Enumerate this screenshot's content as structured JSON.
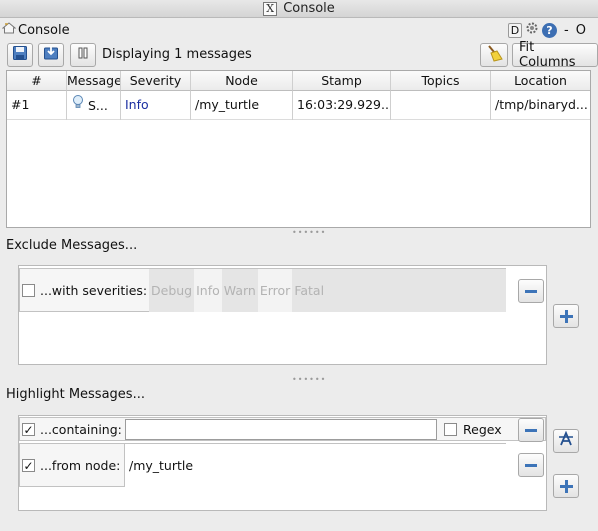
{
  "window": {
    "title": "Console"
  },
  "plugin": {
    "title": "Console",
    "header_buttons": {
      "d_label": "D",
      "help_label": "?",
      "minimize_label": "-",
      "close_label": "O"
    }
  },
  "toolbar": {
    "status_text": "Displaying 1 messages",
    "fit_columns_label": "Fit Columns"
  },
  "table": {
    "columns": [
      "#",
      "Message",
      "Severity",
      "Node",
      "Stamp",
      "Topics",
      "Location"
    ],
    "rows": [
      {
        "id": "#1",
        "message": "S...",
        "severity": "Info",
        "node": "/my_turtle",
        "stamp": "16:03:29.929...",
        "topics": "",
        "location": "/tmp/binaryd..."
      }
    ]
  },
  "exclude": {
    "label": "Exclude Messages...",
    "filter_label": "...with severities:",
    "severities": [
      "Debug",
      "Info",
      "Warn",
      "Error",
      "Fatal"
    ]
  },
  "highlight": {
    "label": "Highlight Messages...",
    "containing": {
      "label": "...containing:",
      "value": "",
      "checked": true,
      "regex_label": "Regex",
      "regex_checked": false
    },
    "from_node": {
      "label": "...from node:",
      "value": "/my_turtle",
      "checked": true
    }
  },
  "colors": {
    "accent": "#3d74b8",
    "severity_info": "#1a2ea0"
  }
}
